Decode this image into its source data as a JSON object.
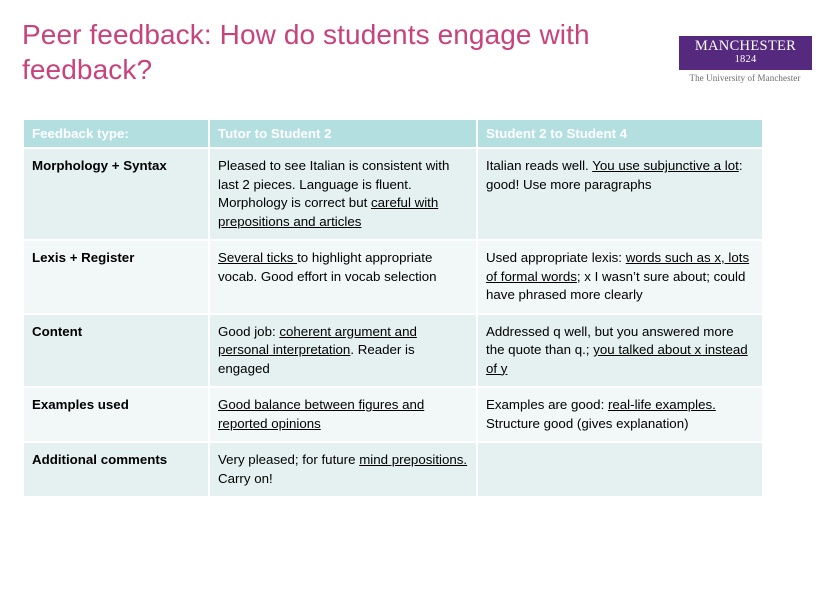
{
  "slide": {
    "title": "Peer feedback: How do students engage with feedback?",
    "title_color": "#C8427B",
    "background": "#FFFFFF"
  },
  "logo": {
    "name": "university-of-manchester-logo",
    "wordmark": "MANCHESTER",
    "year": "1824",
    "tagline": "The University of Manchester",
    "box_color": "#55297E"
  },
  "table": {
    "header_bg": "#B4DFE0",
    "row_bg_dark": "#E5F0F0",
    "row_bg_light": "#F2F8F8",
    "headers": [
      "Feedback type:",
      "Tutor to Student 2",
      "Student 2 to Student 4"
    ],
    "rows": [
      {
        "type": "Morphology + Syntax",
        "tutor": [
          {
            "text": "Pleased to see Italian is consistent with last 2 pieces. Language is fluent. Morphology is correct but ",
            "underline": false
          },
          {
            "text": "careful with prepositions and articles",
            "underline": true
          }
        ],
        "peer": [
          {
            "text": "Italian reads well. ",
            "underline": false
          },
          {
            "text": "You use subjunctive a lot",
            "underline": true
          },
          {
            "text": ": good! Use more paragraphs",
            "underline": false
          }
        ]
      },
      {
        "type": "Lexis + Register",
        "tutor": [
          {
            "text": "Several ticks ",
            "underline": true
          },
          {
            "text": "to highlight appropriate vocab. Good effort in vocab selection",
            "underline": false
          }
        ],
        "peer": [
          {
            "text": "Used appropriate lexis: ",
            "underline": false
          },
          {
            "text": "words such as x, lots of formal words",
            "underline": true
          },
          {
            "text": "; x I wasn’t sure about; could have phrased more clearly",
            "underline": false
          }
        ]
      },
      {
        "type": "Content",
        "tutor": [
          {
            "text": "Good job: ",
            "underline": false
          },
          {
            "text": "coherent argument and personal interpretation",
            "underline": true
          },
          {
            "text": ". Reader is engaged",
            "underline": false
          }
        ],
        "peer": [
          {
            "text": "Addressed q well, but you answered more the quote than q.; ",
            "underline": false
          },
          {
            "text": "you talked about x instead of y",
            "underline": true
          }
        ]
      },
      {
        "type": "Examples used",
        "tutor": [
          {
            "text": "Good balance between figures and reported opinions",
            "underline": true
          }
        ],
        "peer": [
          {
            "text": "Examples are good: ",
            "underline": false
          },
          {
            "text": "real-life examples. ",
            "underline": true
          },
          {
            "text": "Structure good (gives explanation)",
            "underline": false
          }
        ]
      },
      {
        "type": "Additional comments",
        "tutor": [
          {
            "text": "Very pleased; for future ",
            "underline": false
          },
          {
            "text": "mind prepositions. ",
            "underline": true
          },
          {
            "text": "Carry on!",
            "underline": false
          }
        ],
        "peer": []
      }
    ]
  }
}
